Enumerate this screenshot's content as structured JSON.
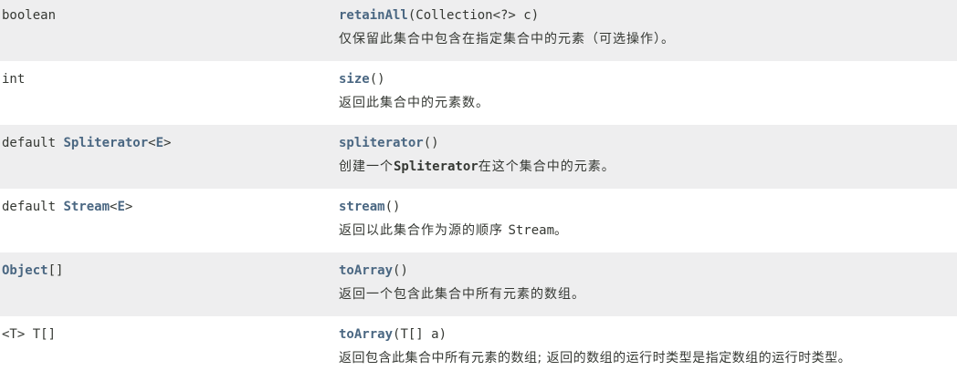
{
  "rows": [
    {
      "type": "boolean",
      "method_name": "retainAll",
      "method_params": "(Collection<?> c)",
      "description": "仅保留此集合中包含在指定集合中的元素（可选操作）。"
    },
    {
      "type": "int",
      "method_name": "size",
      "method_params": "()",
      "description": "返回此集合中的元素数。"
    },
    {
      "type_prefix": "default ",
      "type_link": "Spliterator",
      "type_lt": "<",
      "type_param_link": "E",
      "type_gt": ">",
      "method_name": "spliterator",
      "method_params": "()",
      "desc_before": "创建一个",
      "desc_code": "Spliterator",
      "desc_after": "在这个集合中的元素。"
    },
    {
      "type_prefix": "default ",
      "type_link": "Stream",
      "type_lt": "<",
      "type_param_link": "E",
      "type_gt": ">",
      "method_name": "stream",
      "method_params": "()",
      "desc_before": "返回以此集合作为源的顺序 ",
      "desc_code": "Stream",
      "desc_after": "。"
    },
    {
      "type_link": "Object",
      "type_suffix": "[]",
      "method_name": "toArray",
      "method_params": "()",
      "description": "返回一个包含此集合中所有元素的数组。"
    },
    {
      "type": "<T> T[]",
      "method_name": "toArray",
      "method_params": "(T[] a)",
      "description": "返回包含此集合中所有元素的数组; 返回的数组的运行时类型是指定数组的运行时类型。"
    }
  ]
}
